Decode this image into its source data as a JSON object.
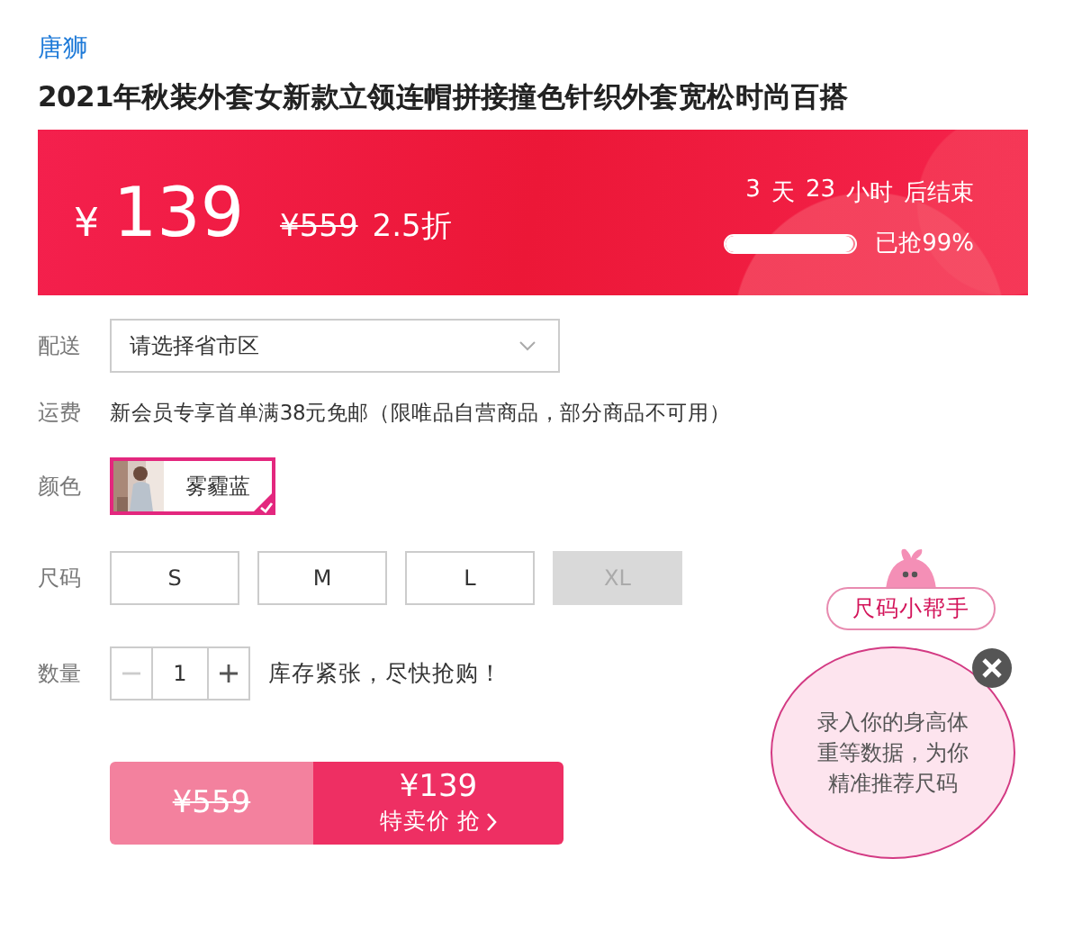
{
  "brand": "唐狮",
  "title": "2021年秋装外套女新款立领连帽拼接撞色针织外套宽松时尚百搭",
  "price_banner": {
    "currency": "¥",
    "price": "139",
    "original_price": "¥559",
    "discount": "2.5折",
    "countdown": {
      "days": "3",
      "days_unit": "天",
      "hours": "23",
      "hours_unit": "小时",
      "suffix": "后结束"
    },
    "sold": {
      "level": 0.99,
      "label": "已抢99%"
    }
  },
  "delivery": {
    "label": "配送",
    "placeholder": "请选择省市区"
  },
  "shipping": {
    "label": "运费",
    "text": "新会员专享首单满38元免邮（限唯品自营商品，部分商品不可用）"
  },
  "color": {
    "label": "颜色",
    "options": [
      {
        "name": "雾霾蓝",
        "selected": true,
        "kind": "picture"
      }
    ]
  },
  "size": {
    "label": "尺码",
    "options": [
      {
        "name": "S",
        "selected": false,
        "disabled": false
      },
      {
        "name": "M",
        "selected": false,
        "disabled": false
      },
      {
        "name": "L",
        "selected": false,
        "disabled": false
      },
      {
        "name": "XL",
        "selected": false,
        "disabled": true
      }
    ]
  },
  "quantity": {
    "label": "数量",
    "value": "1",
    "minus_disabled": true,
    "plus_disabled": false,
    "note": "库存紧张，尽快抢购！"
  },
  "buy_button": {
    "original_price": "¥559",
    "price": "¥139",
    "action": "特卖价 抢"
  },
  "size_helper": {
    "title": "尺码小帮手",
    "text": "录入你的身高体重等数据，为你精准推荐尺码"
  }
}
